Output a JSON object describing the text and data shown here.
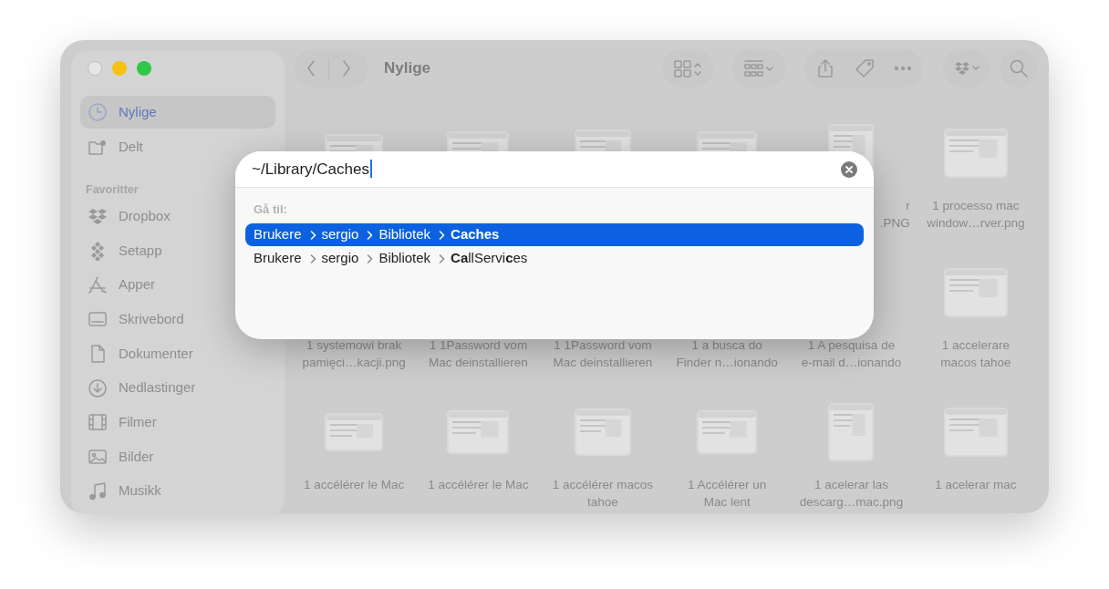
{
  "window": {
    "title": "Nylige"
  },
  "sidebar": {
    "groups": [
      {
        "items": [
          {
            "label": "Nylige",
            "selected": true
          },
          {
            "label": "Delt",
            "selected": false
          }
        ]
      },
      {
        "header": "Favoritter",
        "items": [
          {
            "label": "Dropbox",
            "selected": false
          },
          {
            "label": "Setapp",
            "selected": false
          },
          {
            "label": "Apper",
            "selected": false
          },
          {
            "label": "Skrivebord",
            "selected": false
          },
          {
            "label": "Dokumenter",
            "selected": false
          },
          {
            "label": "Nedlastinger",
            "selected": false
          },
          {
            "label": "Filmer",
            "selected": false
          },
          {
            "label": "Bilder",
            "selected": false
          },
          {
            "label": "Musikk",
            "selected": false
          }
        ]
      }
    ]
  },
  "files": [
    {
      "kind": "unlabeled"
    },
    {
      "kind": "unlabeled"
    },
    {
      "kind": "unlabeled"
    },
    {
      "kind": "unlabeled"
    },
    {
      "kind": "clipped",
      "label": "r\n.PNG"
    },
    {
      "kind": "whole",
      "label": "1  processo mac\nwindow…rver.png"
    },
    {
      "kind": "label_only",
      "label": "1 systemowi brak\npamięci…kacji.png"
    },
    {
      "kind": "label_only",
      "label": "1 1Password vom\nMac deinstallieren"
    },
    {
      "kind": "label_only",
      "label": "1 1Password vom\nMac deinstallieren"
    },
    {
      "kind": "label_only",
      "label": "1 a busca do\nFinder n…ionando"
    },
    {
      "kind": "whole",
      "label": "1 A pesquisa de\ne-mail d…ionando"
    },
    {
      "kind": "whole",
      "label": "1 accelerare\nmacos tahoe"
    },
    {
      "kind": "whole",
      "label": "1 accélérer le Mac"
    },
    {
      "kind": "whole",
      "label": "1 accélérer le Mac"
    },
    {
      "kind": "whole",
      "label": "1 accélérer macos\ntahoe"
    },
    {
      "kind": "whole",
      "label": "1 Accélérer un\nMac lent"
    },
    {
      "kind": "whole",
      "label": "1 acelerar las\ndescarg…mac.png"
    },
    {
      "kind": "whole",
      "label": "1 acelerar mac"
    }
  ],
  "dialog": {
    "path_field": {
      "value": "~/Library/Caches"
    },
    "heading": "Gå til:",
    "suggestions": [
      {
        "selected": true,
        "segments": [
          "Brukere",
          "sergio",
          "Bibliotek",
          "**Caches**"
        ]
      },
      {
        "selected": false,
        "segments": [
          "Brukere",
          "sergio",
          "Bibliotek",
          "**Ca**llServi**c**es"
        ]
      }
    ]
  }
}
